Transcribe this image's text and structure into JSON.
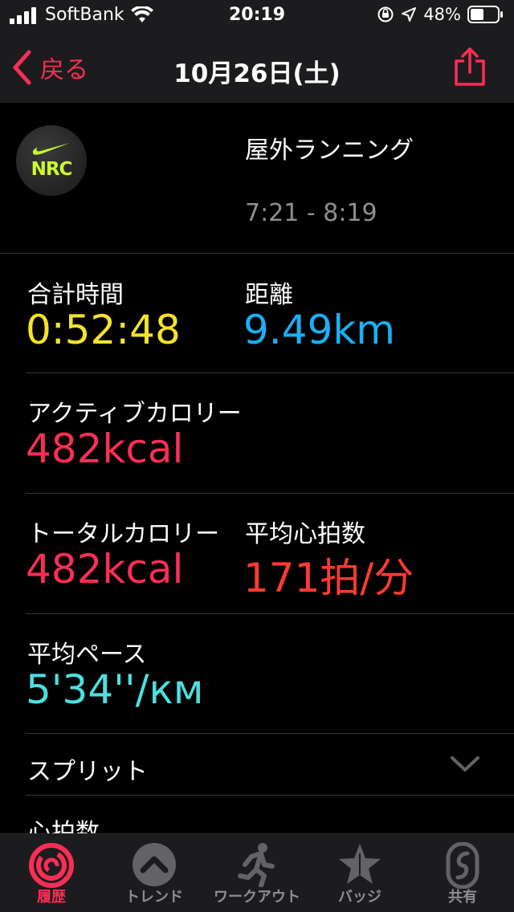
{
  "status_bar": {
    "carrier": "SoftBank",
    "time": "20:19",
    "battery": "48%"
  },
  "nav": {
    "back_label": "戻る",
    "title": "10月26日(土)"
  },
  "workout": {
    "app_badge": "NRC",
    "type": "屋外ランニング",
    "time_range": "7:21 - 8:19"
  },
  "stats": {
    "total_time_label": "合計時間",
    "total_time_value": "0:52:48",
    "distance_label": "距離",
    "distance_value": "9.49km",
    "active_cal_label": "アクティブカロリー",
    "active_cal_value": "482kcal",
    "total_cal_label": "トータルカロリー",
    "total_cal_value": "482kcal",
    "avg_hr_label": "平均心拍数",
    "avg_hr_value": "171拍/分",
    "avg_pace_label": "平均ペース",
    "avg_pace_value": "5'34''/км"
  },
  "split_label": "スプリット",
  "heart_rate_label": "心拍数",
  "tabs": [
    {
      "label": "履歴",
      "active": true
    },
    {
      "label": "トレンド",
      "active": false
    },
    {
      "label": "ワークアウト",
      "active": false
    },
    {
      "label": "バッジ",
      "active": false
    },
    {
      "label": "共有",
      "active": false
    }
  ],
  "colors": {
    "accent": "#fa2e55",
    "yellow": "#f5e32a",
    "blue": "#1ab0f5",
    "orange": "#ff3b30",
    "cyan": "#4ce0e0",
    "nrc_volt": "#cdfa2c"
  }
}
